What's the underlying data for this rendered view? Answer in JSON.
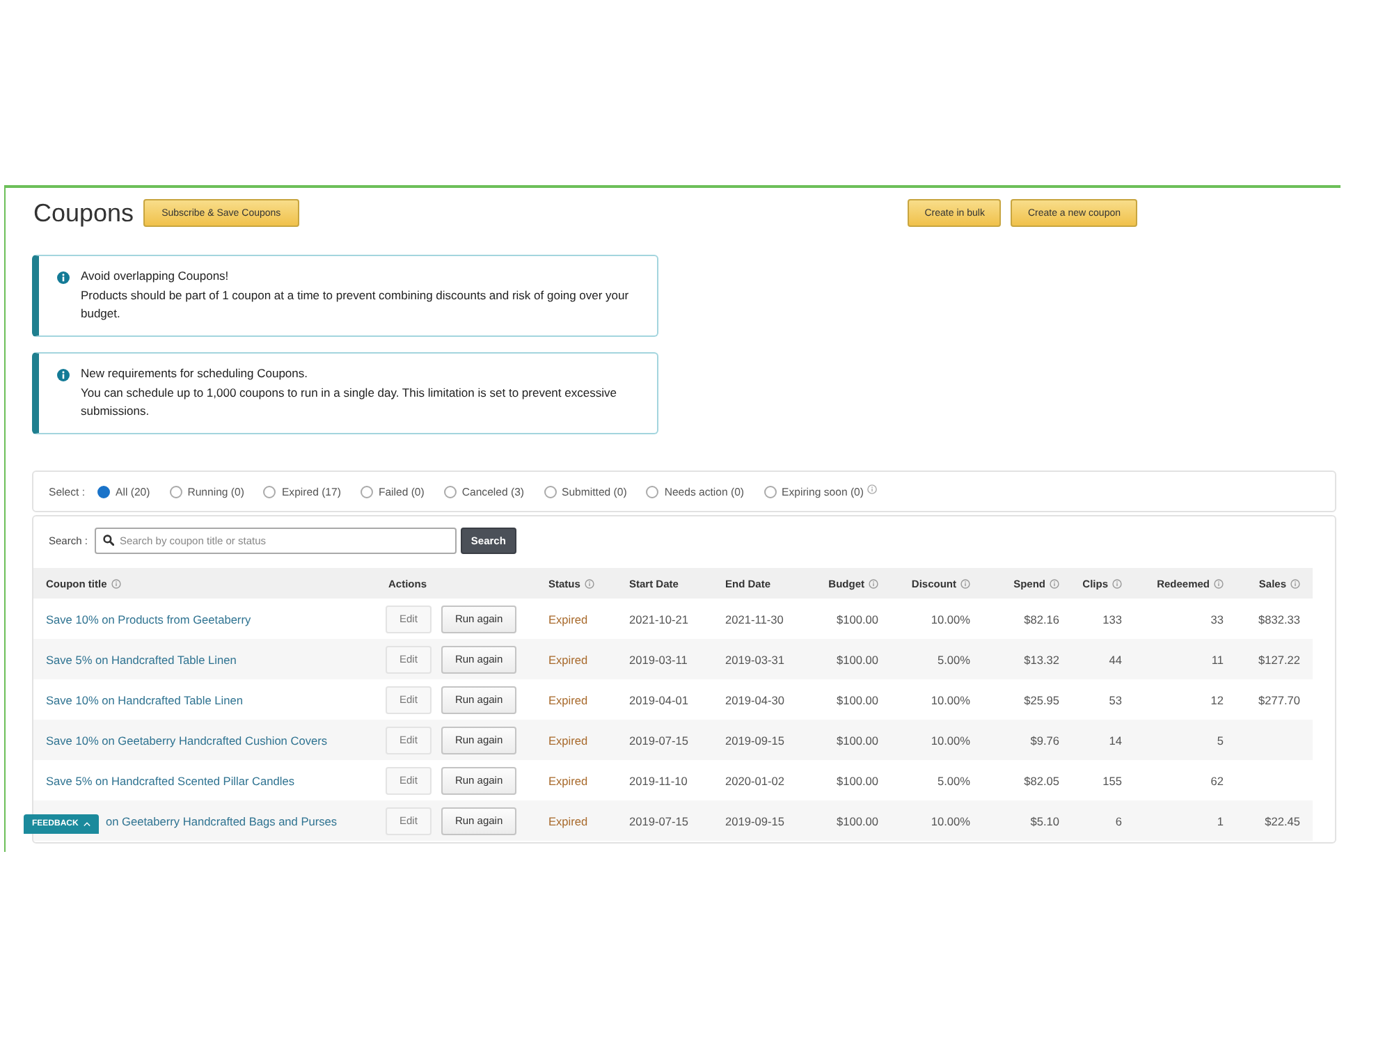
{
  "header": {
    "title": "Coupons",
    "subscribe_button": "Subscribe & Save Coupons",
    "actions": [
      "Create in bulk",
      "Create a new coupon"
    ]
  },
  "alerts": [
    {
      "heading": "Avoid overlapping Coupons!",
      "text": "Products should be part of 1 coupon at a time to prevent combining discounts and risk of going over your budget."
    },
    {
      "heading": "New requirements for scheduling Coupons.",
      "text": "You can schedule up to 1,000 coupons to run in a single day. This limitation is set to prevent excessive submissions."
    }
  ],
  "filter": {
    "label": "Select :",
    "options": [
      {
        "label": "All (20)",
        "selected": true,
        "info": false
      },
      {
        "label": "Running (0)",
        "selected": false,
        "info": false
      },
      {
        "label": "Expired (17)",
        "selected": false,
        "info": false
      },
      {
        "label": "Failed (0)",
        "selected": false,
        "info": false
      },
      {
        "label": "Canceled (3)",
        "selected": false,
        "info": false
      },
      {
        "label": "Submitted (0)",
        "selected": false,
        "info": false
      },
      {
        "label": "Needs action (0)",
        "selected": false,
        "info": false
      },
      {
        "label": "Expiring soon (0)",
        "selected": false,
        "info": true
      }
    ]
  },
  "search": {
    "label": "Search :",
    "placeholder": "Search by coupon title or status",
    "button": "Search"
  },
  "table": {
    "columns": [
      {
        "label": "Coupon title",
        "info": true
      },
      {
        "label": "Actions",
        "info": false
      },
      {
        "label": "Status",
        "info": true
      },
      {
        "label": "Start Date",
        "info": false
      },
      {
        "label": "End Date",
        "info": false
      },
      {
        "label": "Budget",
        "info": true
      },
      {
        "label": "Discount",
        "info": true
      },
      {
        "label": "Spend",
        "info": true
      },
      {
        "label": "Clips",
        "info": true
      },
      {
        "label": "Redeemed",
        "info": true
      },
      {
        "label": "Sales",
        "info": true
      }
    ],
    "rows": [
      {
        "title": "Save 10% on Products from Geetaberry",
        "actions": [
          "Edit",
          "Run again"
        ],
        "values": [
          "Expired",
          "2021-10-21",
          "2021-11-30",
          "$100.00",
          "10.00%",
          "$82.16",
          "133",
          "33",
          "$832.33"
        ]
      },
      {
        "title": "Save 5% on Handcrafted Table Linen",
        "actions": [
          "Edit",
          "Run again"
        ],
        "values": [
          "Expired",
          "2019-03-11",
          "2019-03-31",
          "$100.00",
          "5.00%",
          "$13.32",
          "44",
          "11",
          "$127.22"
        ]
      },
      {
        "title": "Save 10% on Handcrafted Table Linen",
        "actions": [
          "Edit",
          "Run again"
        ],
        "values": [
          "Expired",
          "2019-04-01",
          "2019-04-30",
          "$100.00",
          "10.00%",
          "$25.95",
          "53",
          "12",
          "$277.70"
        ]
      },
      {
        "title": "Save 10% on Geetaberry Handcrafted Cushion Covers",
        "actions": [
          "Edit",
          "Run again"
        ],
        "values": [
          "Expired",
          "2019-07-15",
          "2019-09-15",
          "$100.00",
          "10.00%",
          "$9.76",
          "14",
          "5"
        ]
      },
      {
        "title": "Save 5% on Handcrafted Scented Pillar Candles",
        "actions": [
          "Edit",
          "Run again"
        ],
        "values": [
          "Expired",
          "2019-11-10",
          "2020-01-02",
          "$100.00",
          "5.00%",
          "$82.05",
          "155",
          "62"
        ]
      },
      {
        "title": "on Geetaberry Handcrafted Bags and Purses",
        "actions": [
          "Edit",
          "Run again"
        ],
        "values": [
          "Expired",
          "2019-07-15",
          "2019-09-15",
          "$100.00",
          "10.00%",
          "$5.10",
          "6",
          "1",
          "$22.45"
        ]
      }
    ]
  },
  "feedback_tab": {
    "label": "FEEDBACK"
  }
}
